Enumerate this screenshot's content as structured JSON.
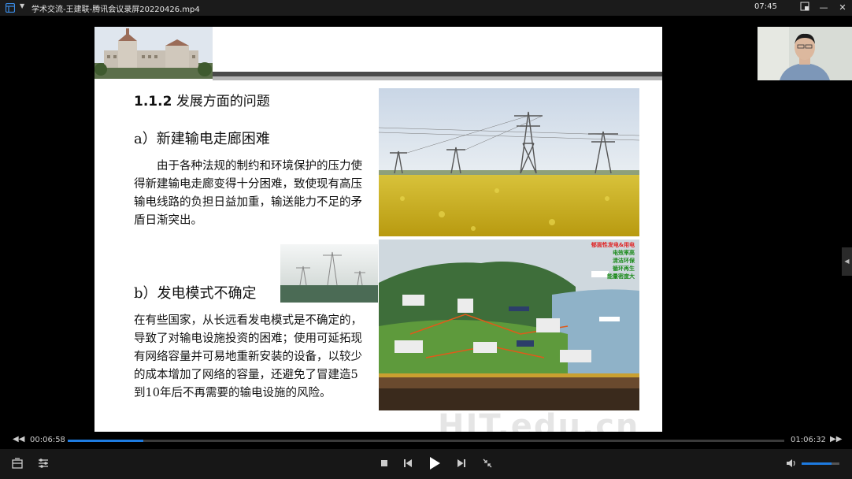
{
  "window": {
    "title": "学术交流-王建联-腾讯会议录屏20220426.mp4",
    "clock": "07:45"
  },
  "slide": {
    "heading_num": "1.1.2",
    "heading_text": "发展方面的问题",
    "section_a_title": "a）新建输电走廊困难",
    "section_a_body": "由于各种法规的制约和环境保护的压力使得新建输电走廊变得十分困难，致使现有高压输电线路的负担日益加重，输送能力不足的矛盾日渐突出。",
    "section_b_title": "b）发电模式不确定",
    "section_b_body": "在有些国家，从长远看发电模式是不确定的，导致了对输电设施投资的困难；使用可延拓现有网络容量并可易地重新安装的设备，以较少的成本增加了网络的容量，还避免了冒建造5到10年后不再需要的输电设施的风险。",
    "energy_labels": [
      "郁面性发电&用电",
      "电效率高",
      "清洁环保",
      "循环再生",
      "能量密度大"
    ],
    "watermark": "HIT.edu.cn"
  },
  "player": {
    "elapsed": "00:06:58",
    "duration": "01:06:32",
    "progress": 0.105,
    "volume": 0.8
  },
  "colors": {
    "accent": "#1e7be0",
    "bar_bg": "#171717"
  }
}
